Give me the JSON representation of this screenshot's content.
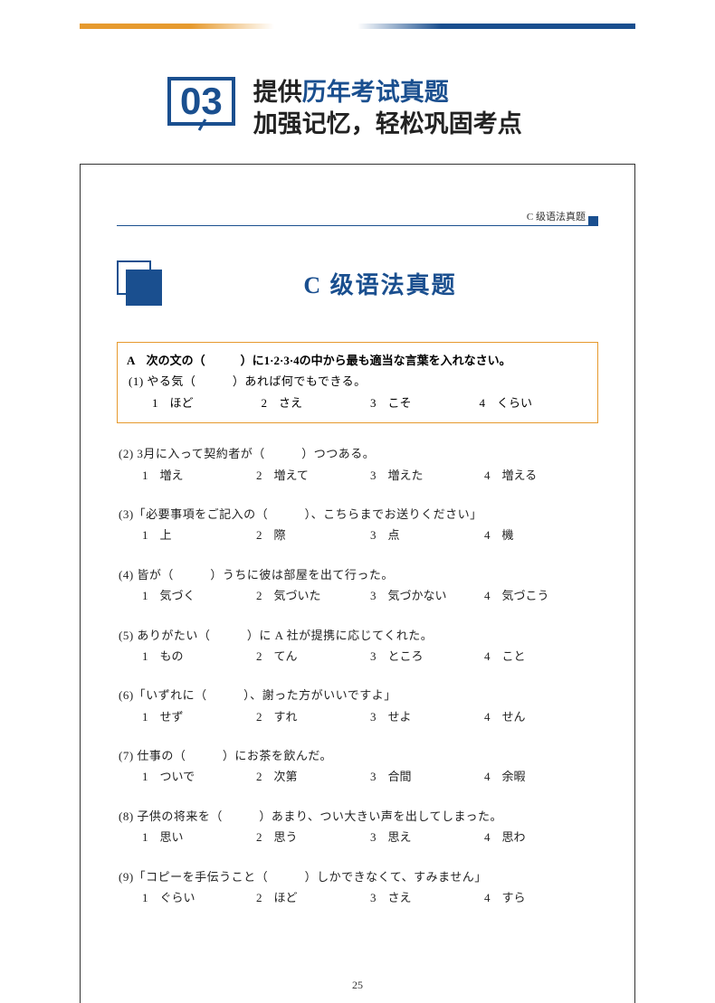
{
  "header": {
    "number": "03",
    "line1_prefix": "提供",
    "line1_highlight": "历年考试真题",
    "line2": "加强记忆，轻松巩固考点"
  },
  "page": {
    "running_head": "C 级语法真题",
    "title": "C 级语法真题",
    "page_number": "25",
    "section_instr": "A　次の文の（　　　）に1·2·3·4の中から最も適当な言葉を入れなさい。",
    "q1": {
      "text": "(1) やる気（　　　）あれば何でもできる。",
      "choices": [
        "1　ほど",
        "2　さえ",
        "3　こそ",
        "4　くらい"
      ]
    },
    "questions": [
      {
        "text": "(2) 3月に入って契約者が（　　　）つつある。",
        "choices": [
          "1　増え",
          "2　増えて",
          "3　増えた",
          "4　増える"
        ]
      },
      {
        "text": "(3)「必要事項をご記入の（　　　）、こちらまでお送りください」",
        "choices": [
          "1　上",
          "2　際",
          "3　点",
          "4　機"
        ]
      },
      {
        "text": "(4) 皆が（　　　）うちに彼は部屋を出て行った。",
        "choices": [
          "1　気づく",
          "2　気づいた",
          "3　気づかない",
          "4　気づこう"
        ]
      },
      {
        "text": "(5) ありがたい（　　　）に A 社が提携に応じてくれた。",
        "choices": [
          "1　もの",
          "2　てん",
          "3　ところ",
          "4　こと"
        ]
      },
      {
        "text": "(6)「いずれに（　　　）、謝った方がいいですよ」",
        "choices": [
          "1　せず",
          "2　すれ",
          "3　せよ",
          "4　せん"
        ]
      },
      {
        "text": "(7) 仕事の（　　　）にお茶を飲んだ。",
        "choices": [
          "1　ついで",
          "2　次第",
          "3　合間",
          "4　余暇"
        ]
      },
      {
        "text": "(8) 子供の将来を（　　　）あまり、つい大きい声を出してしまった。",
        "choices": [
          "1　思い",
          "2　思う",
          "3　思え",
          "4　思わ"
        ]
      },
      {
        "text": "(9)「コピーを手伝うこと（　　　）しかできなくて、すみません」",
        "choices": [
          "1　ぐらい",
          "2　ほど",
          "3　さえ",
          "4　すら"
        ]
      }
    ]
  }
}
